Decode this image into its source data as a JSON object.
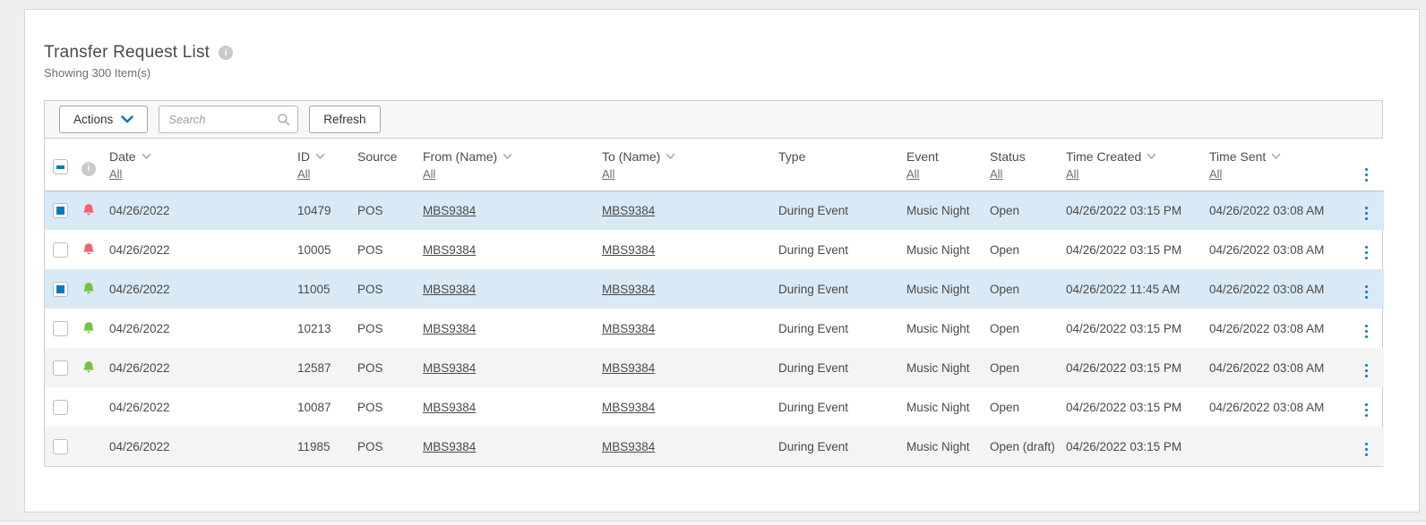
{
  "page": {
    "title": "Transfer Request List",
    "subtitle": "Showing 300 Item(s)"
  },
  "toolbar": {
    "actions_label": "Actions",
    "search_placeholder": "Search",
    "refresh_label": "Refresh"
  },
  "table": {
    "select_all_state": "indeterminate",
    "columns": [
      {
        "label": "Date",
        "sortable": true,
        "filter": "All"
      },
      {
        "label": "ID",
        "sortable": true,
        "filter": "All"
      },
      {
        "label": "Source",
        "sortable": false,
        "filter": null
      },
      {
        "label": "From (Name)",
        "sortable": true,
        "filter": "All"
      },
      {
        "label": "To (Name)",
        "sortable": true,
        "filter": "All"
      },
      {
        "label": "Type",
        "sortable": false,
        "filter": null
      },
      {
        "label": "Event",
        "sortable": false,
        "filter": "All"
      },
      {
        "label": "Status",
        "sortable": false,
        "filter": "All"
      },
      {
        "label": "Time Created",
        "sortable": true,
        "filter": "All"
      },
      {
        "label": "Time Sent",
        "sortable": true,
        "filter": "All"
      }
    ],
    "rows": [
      {
        "checked": true,
        "bell": "red",
        "date": "04/26/2022",
        "id": "10479",
        "source": "POS",
        "from": "MBS9384",
        "to": "MBS9384",
        "type": "During Event",
        "event": "Music Night",
        "status": "Open",
        "time_created": "04/26/2022 03:15 PM",
        "time_sent": "04/26/2022 03:08 AM"
      },
      {
        "checked": false,
        "bell": "red",
        "date": "04/26/2022",
        "id": "10005",
        "source": "POS",
        "from": "MBS9384",
        "to": "MBS9384",
        "type": "During Event",
        "event": "Music Night",
        "status": "Open",
        "time_created": "04/26/2022 03:15 PM",
        "time_sent": "04/26/2022 03:08 AM"
      },
      {
        "checked": true,
        "bell": "green",
        "date": "04/26/2022",
        "id": "11005",
        "source": "POS",
        "from": "MBS9384",
        "to": "MBS9384",
        "type": "During Event",
        "event": "Music Night",
        "status": "Open",
        "time_created": "04/26/2022 11:45 AM",
        "time_sent": "04/26/2022 03:08 AM"
      },
      {
        "checked": false,
        "bell": "green",
        "date": "04/26/2022",
        "id": "10213",
        "source": "POS",
        "from": "MBS9384",
        "to": "MBS9384",
        "type": "During Event",
        "event": "Music Night",
        "status": "Open",
        "time_created": "04/26/2022 03:15 PM",
        "time_sent": "04/26/2022 03:08 AM"
      },
      {
        "checked": false,
        "bell": "green",
        "date": "04/26/2022",
        "id": "12587",
        "source": "POS",
        "from": "MBS9384",
        "to": "MBS9384",
        "type": "During Event",
        "event": "Music Night",
        "status": "Open",
        "time_created": "04/26/2022 03:15 PM",
        "time_sent": "04/26/2022 03:08 AM"
      },
      {
        "checked": false,
        "bell": null,
        "date": "04/26/2022",
        "id": "10087",
        "source": "POS",
        "from": "MBS9384",
        "to": "MBS9384",
        "type": "During Event",
        "event": "Music Night",
        "status": "Open",
        "time_created": "04/26/2022 03:15 PM",
        "time_sent": "04/26/2022 03:08 AM"
      },
      {
        "checked": false,
        "bell": null,
        "date": "04/26/2022",
        "id": "11985",
        "source": "POS",
        "from": "MBS9384",
        "to": "MBS9384",
        "type": "During Event",
        "event": "Music Night",
        "status": "Open (draft)",
        "time_created": "04/26/2022 03:15 PM",
        "time_sent": ""
      }
    ]
  },
  "icons": {
    "title_info": "info-icon",
    "header_info": "info-icon",
    "actions_dropdown": "chevron-down-icon",
    "search": "search-icon",
    "column_sort": "chevron-down-icon",
    "row_alert": "bell-icon",
    "row_menu": "kebab-vertical-icon"
  },
  "colors": {
    "accent_blue": "#0079c1",
    "selected_row": "#d9e9f5",
    "bell_red": "#f4606c",
    "bell_green": "#77c043"
  }
}
